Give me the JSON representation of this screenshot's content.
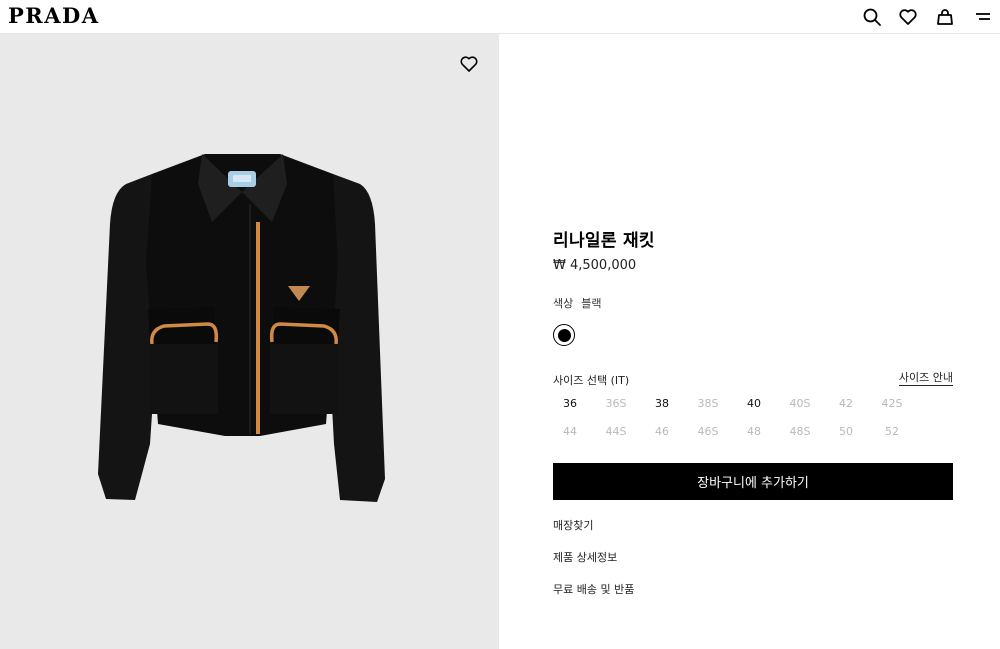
{
  "header": {
    "logo": "PRADA",
    "icons": [
      "search-icon",
      "heart-icon",
      "bag-icon",
      "menu-icon"
    ]
  },
  "media": {
    "favorite_icon": "heart-icon",
    "image": "black nylon cropped jacket with orange trim",
    "background": "#e9e9e9"
  },
  "product": {
    "title": "리나일론 재킷",
    "price": "₩ 4,500,000",
    "color_label": "색상",
    "color_value": "블랙",
    "swatch_color": "#000000",
    "size_label": "사이즈 선택 (IT)",
    "size_guide": "사이즈 안내",
    "sizes": [
      {
        "label": "36",
        "available": true
      },
      {
        "label": "36S",
        "available": false
      },
      {
        "label": "38",
        "available": true
      },
      {
        "label": "38S",
        "available": false
      },
      {
        "label": "40",
        "available": true
      },
      {
        "label": "40S",
        "available": false
      },
      {
        "label": "42",
        "available": false
      },
      {
        "label": "42S",
        "available": false
      },
      {
        "label": "44",
        "available": false
      },
      {
        "label": "44S",
        "available": false
      },
      {
        "label": "46",
        "available": false
      },
      {
        "label": "46S",
        "available": false
      },
      {
        "label": "48",
        "available": false
      },
      {
        "label": "48S",
        "available": false
      },
      {
        "label": "50",
        "available": false
      },
      {
        "label": "52",
        "available": false
      }
    ],
    "add_to_cart": "장바구니에 추가하기",
    "links": [
      "매장찾기",
      "제품 상세정보",
      "무료 배송 및 반품"
    ]
  }
}
